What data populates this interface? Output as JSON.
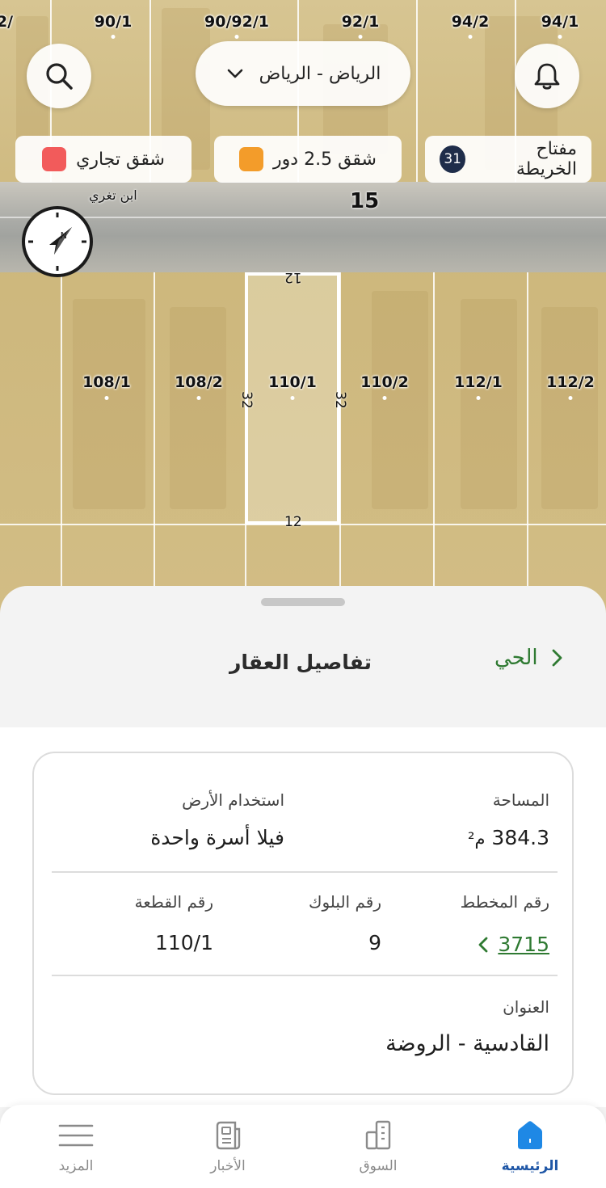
{
  "map": {
    "top_plots": [
      "2/",
      "90/1",
      "90/92/1",
      "92/1",
      "94/2",
      "94/1"
    ],
    "bottom_plots": [
      "108/1",
      "108/2",
      "110/1",
      "110/2",
      "112/1",
      "112/2"
    ],
    "selected_dims": {
      "top": "12",
      "bottom": "12",
      "left": "32",
      "right": "32"
    },
    "street_name": "ابن تغري",
    "street_number": "15",
    "city_selector": "الرياض - الرياض",
    "legend": {
      "key_label": "مفتاح الخريطة",
      "key_count": "31",
      "apartments_label": "شقق 2.5 دور",
      "apartments_color": "#f39c2a",
      "commercial_label": "شقق تجاري",
      "commercial_color": "#f25b5b"
    }
  },
  "sheet": {
    "title": "تفاصيل العقار",
    "back_link": "الحي",
    "area_label": "المساحة",
    "area_value": "384.3",
    "area_unit": "م²",
    "land_use_label": "استخدام الأرض",
    "land_use_value": "فيلا أسرة واحدة",
    "plan_label": "رقم المخطط",
    "plan_value": "3715",
    "block_label": "رقم البلوك",
    "block_value": "9",
    "parcel_label": "رقم القطعة",
    "parcel_value": "110/1",
    "address_label": "العنوان",
    "address_value": "القادسية - الروضة"
  },
  "nav": {
    "home": "الرئيسية",
    "market": "السوق",
    "news": "الأخبار",
    "more": "المزيد"
  },
  "colors": {
    "accent_green": "#2f7a32",
    "nav_active": "#1e56a6",
    "badge": "#1f2d4a"
  }
}
